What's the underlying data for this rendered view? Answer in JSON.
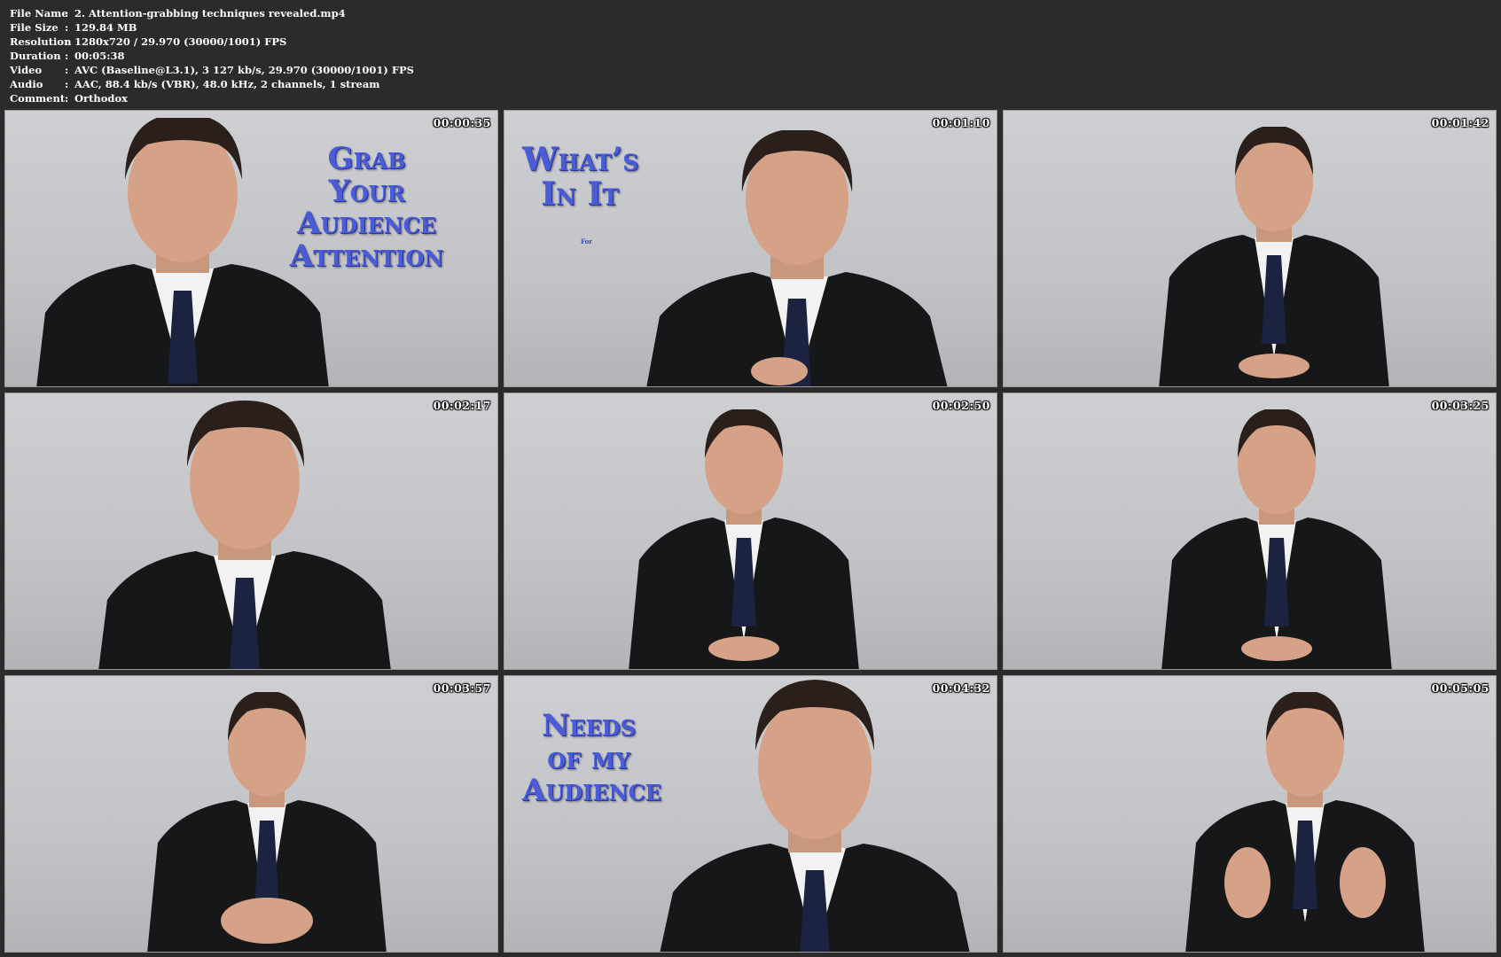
{
  "file_info": [
    {
      "key": "File Name",
      "value": "2. Attention-grabbing techniques revealed.mp4"
    },
    {
      "key": "File Size",
      "value": "129.84 MB"
    },
    {
      "key": "Resolution",
      "value": "1280x720 / 29.970 (30000/1001) FPS"
    },
    {
      "key": "Duration",
      "value": "00:05:38"
    },
    {
      "key": "Video",
      "value": "AVC (Baseline@L3.1), 3 127 kb/s, 29.970 (30000/1001) FPS"
    },
    {
      "key": "Audio",
      "value": "AAC, 88.4 kb/s (VBR), 48.0 kHz, 2 channels, 1 stream"
    },
    {
      "key": "Comment",
      "value": "Orthodox"
    }
  ],
  "separator": ":",
  "thumbnails": [
    {
      "timestamp": "00:00:35",
      "caption": [
        "Grab Your",
        "Audience",
        "Attention"
      ]
    },
    {
      "timestamp": "00:01:10",
      "caption": [
        "What’s",
        "In It"
      ],
      "note": "For"
    },
    {
      "timestamp": "00:01:42"
    },
    {
      "timestamp": "00:02:17"
    },
    {
      "timestamp": "00:02:50"
    },
    {
      "timestamp": "00:03:25"
    },
    {
      "timestamp": "00:03:57"
    },
    {
      "timestamp": "00:04:32",
      "caption": [
        "Needs",
        "of my",
        "Audience"
      ]
    },
    {
      "timestamp": "00:05:05"
    }
  ],
  "colors": {
    "background": "#2b2b2b",
    "caption_text": "#4a5cd6",
    "frame_bg": "#c6c8cb"
  }
}
